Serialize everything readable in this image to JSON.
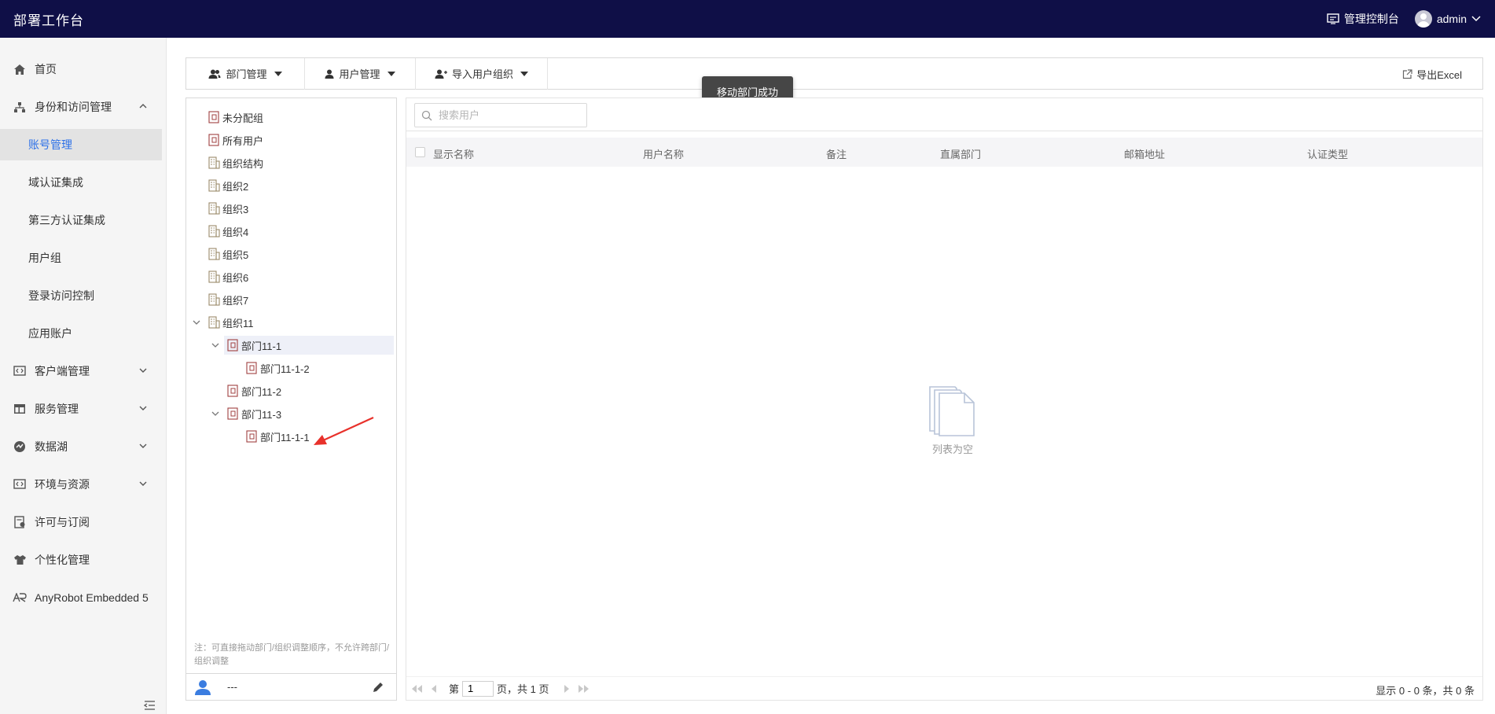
{
  "app": {
    "title": "部署工作台"
  },
  "header": {
    "console_label": "管理控制台",
    "user_label": "admin"
  },
  "sidebar": {
    "home": "首页",
    "identity": "身份和访问管理",
    "identity_children": [
      "账号管理",
      "域认证集成",
      "第三方认证集成",
      "用户组",
      "登录访问控制",
      "应用账户"
    ],
    "client": "客户端管理",
    "service": "服务管理",
    "datalake": "数据湖",
    "env": "环境与资源",
    "license": "许可与订阅",
    "personalize": "个性化管理",
    "anyrobot": "AnyRobot Embedded 5"
  },
  "toolbar": {
    "dept_label": "部门管理",
    "user_label": "用户管理",
    "import_label": "导入用户组织",
    "export_label": "导出Excel"
  },
  "toast": {
    "message": "移动部门成功"
  },
  "tree": {
    "unassigned": "未分配组",
    "all_users": "所有用户",
    "org_structure": "组织结构",
    "org2": "组织2",
    "org3": "组织3",
    "org4": "组织4",
    "org5": "组织5",
    "org6": "组织6",
    "org7": "组织7",
    "org11": "组织11",
    "dept11_1": "部门11-1",
    "dept11_1_2": "部门11-1-2",
    "dept11_2": "部门11-2",
    "dept11_3": "部门11-3",
    "dept11_1_1": "部门11-1-1",
    "note": "注：可直接拖动部门/组织调整顺序，不允许跨部门/组织调整",
    "footer_user": "---"
  },
  "search": {
    "placeholder": "搜索用户"
  },
  "table": {
    "columns": [
      "显示名称",
      "用户名称",
      "备注",
      "直属部门",
      "邮箱地址",
      "认证类型"
    ],
    "empty_text": "列表为空"
  },
  "pager": {
    "prefix": "第",
    "page": "1",
    "suffix": "页，共 1 页",
    "summary": "显示 0 - 0 条，共 0 条"
  },
  "colors": {
    "topbar": "#0f0f47",
    "active_link": "#2c70e8",
    "arrow": "#e8312b"
  }
}
